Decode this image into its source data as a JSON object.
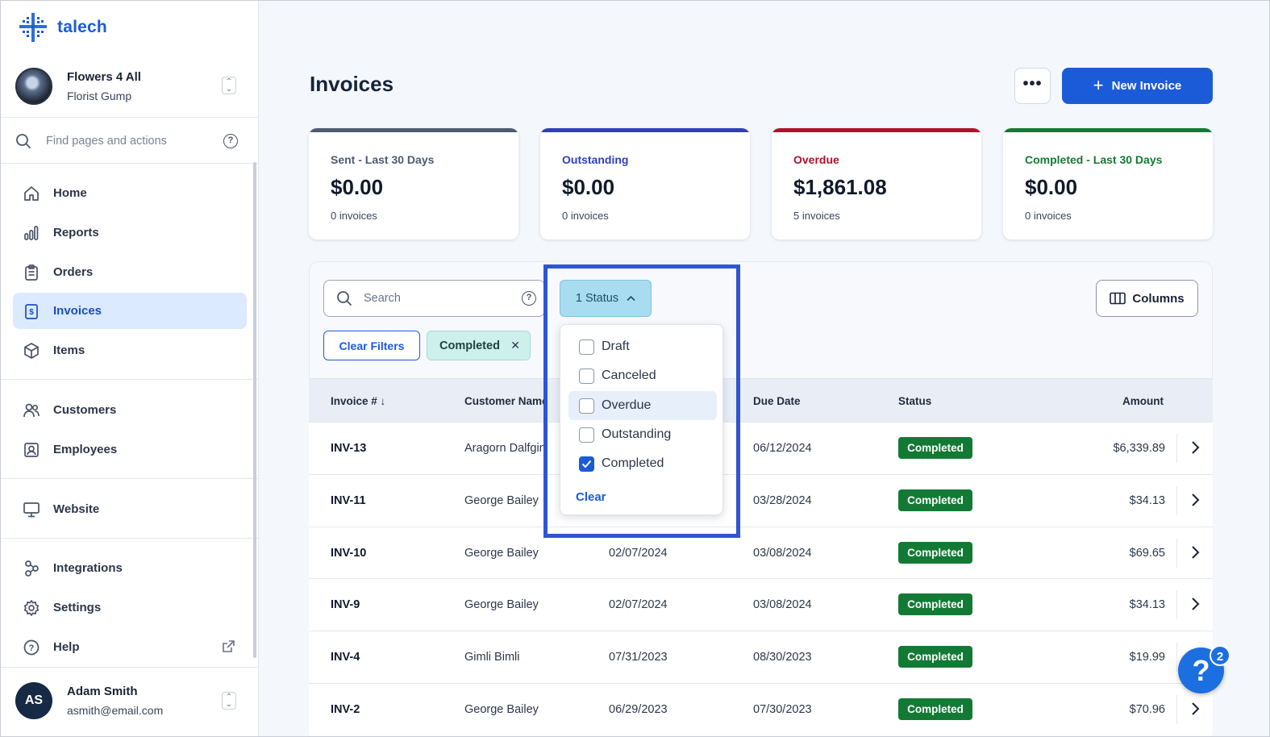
{
  "app": {
    "logo_text": "talech"
  },
  "org": {
    "name": "Flowers 4 All",
    "sub": "Florist Gump"
  },
  "find": {
    "placeholder": "Find pages and actions"
  },
  "sidebar": {
    "items": [
      {
        "label": "Home",
        "icon": "home-icon"
      },
      {
        "label": "Reports",
        "icon": "bar-chart-icon"
      },
      {
        "label": "Orders",
        "icon": "clipboard-icon"
      },
      {
        "label": "Invoices",
        "icon": "invoice-icon",
        "active": true
      },
      {
        "label": "Items",
        "icon": "box-icon"
      },
      {
        "label": "Customers",
        "icon": "users-icon"
      },
      {
        "label": "Employees",
        "icon": "id-badge-icon"
      },
      {
        "label": "Website",
        "icon": "monitor-icon"
      },
      {
        "label": "Integrations",
        "icon": "nodes-icon"
      },
      {
        "label": "Settings",
        "icon": "gear-icon"
      },
      {
        "label": "Help",
        "icon": "help-circle-icon"
      }
    ]
  },
  "user": {
    "initials": "AS",
    "name": "Adam Smith",
    "email": "asmith@email.com"
  },
  "header": {
    "title": "Invoices",
    "more_label": "•••",
    "new_label": "New Invoice"
  },
  "cards": [
    {
      "label": "Sent - Last 30 Days",
      "amount": "$0.00",
      "count": "0 invoices",
      "color": "#4d5b72"
    },
    {
      "label": "Outstanding",
      "amount": "$0.00",
      "count": "0 invoices",
      "color": "#2f3fb8"
    },
    {
      "label": "Overdue",
      "amount": "$1,861.08",
      "count": "5 invoices",
      "color": "#b0122a"
    },
    {
      "label": "Completed - Last 30 Days",
      "amount": "$0.00",
      "count": "0 invoices",
      "color": "#137a35"
    }
  ],
  "toolbar": {
    "search_placeholder": "Search",
    "status_label": "1 Status",
    "columns_label": "Columns",
    "clear_filters_label": "Clear Filters",
    "chip_label": "Completed"
  },
  "dropdown": {
    "options": [
      {
        "label": "Draft",
        "checked": false
      },
      {
        "label": "Canceled",
        "checked": false
      },
      {
        "label": "Overdue",
        "checked": false
      },
      {
        "label": "Outstanding",
        "checked": false
      },
      {
        "label": "Completed",
        "checked": true
      }
    ],
    "clear_label": "Clear"
  },
  "table": {
    "headers": {
      "invoice": "Invoice #",
      "customer": "Customer Name",
      "due": "Due Date",
      "status": "Status",
      "amount": "Amount"
    },
    "rows": [
      {
        "invoice": "INV-13",
        "customer": "Aragorn Dalfgin",
        "date": "",
        "due": "06/12/2024",
        "status": "Completed",
        "amount": "$6,339.89"
      },
      {
        "invoice": "INV-11",
        "customer": "George Bailey",
        "date": "",
        "due": "03/28/2024",
        "status": "Completed",
        "amount": "$34.13"
      },
      {
        "invoice": "INV-10",
        "customer": "George Bailey",
        "date": "02/07/2024",
        "due": "03/08/2024",
        "status": "Completed",
        "amount": "$69.65"
      },
      {
        "invoice": "INV-9",
        "customer": "George Bailey",
        "date": "02/07/2024",
        "due": "03/08/2024",
        "status": "Completed",
        "amount": "$34.13"
      },
      {
        "invoice": "INV-4",
        "customer": "Gimli Bimli",
        "date": "07/31/2023",
        "due": "08/30/2023",
        "status": "Completed",
        "amount": "$19.99"
      },
      {
        "invoice": "INV-2",
        "customer": "George Bailey",
        "date": "06/29/2023",
        "due": "07/30/2023",
        "status": "Completed",
        "amount": "$70.96"
      }
    ]
  },
  "help_fab": {
    "symbol": "?",
    "count": "2"
  }
}
